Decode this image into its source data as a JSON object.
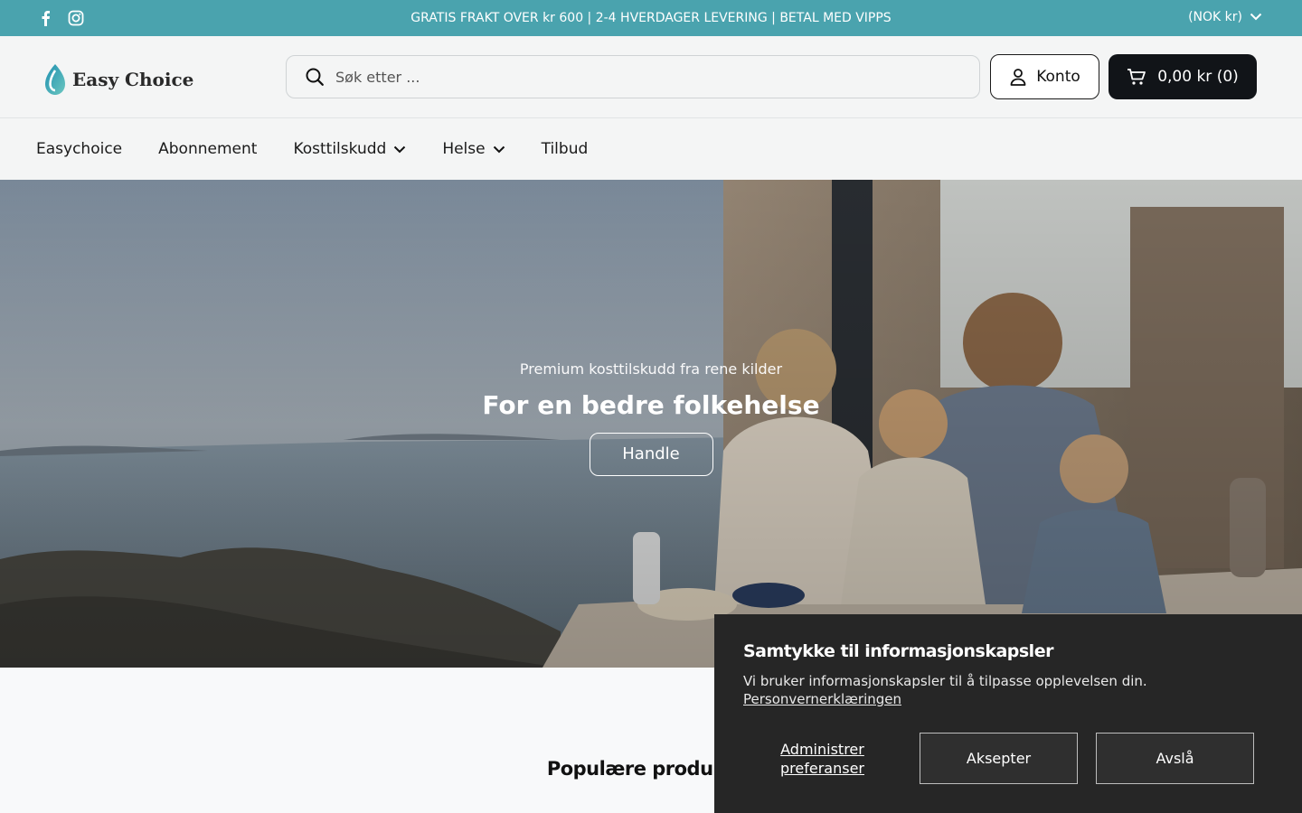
{
  "announcement": {
    "message": "GRATIS FRAKT OVER kr 600 | 2-4 HVERDAGER LEVERING | BETAL MED VIPPS",
    "currency": "(NOK kr)",
    "social": [
      "facebook-icon",
      "instagram-icon"
    ]
  },
  "header": {
    "logo_text": "Easy Choice",
    "search_placeholder": "Søk etter ...",
    "account_label": "Konto",
    "cart_label": "0,00 kr (0)"
  },
  "nav": {
    "items": [
      {
        "label": "Easychoice",
        "dropdown": false
      },
      {
        "label": "Abonnement",
        "dropdown": false
      },
      {
        "label": "Kosttilskudd",
        "dropdown": true
      },
      {
        "label": "Helse",
        "dropdown": true
      },
      {
        "label": "Tilbud",
        "dropdown": false
      }
    ]
  },
  "hero": {
    "kicker": "Premium kosttilskudd fra rene kilder",
    "headline": "For en bedre folkehelse",
    "cta": "Handle"
  },
  "products": {
    "heading": "Populære produkter"
  },
  "cookie": {
    "title": "Samtykke til informasjonskapsler",
    "text": "Vi bruker informasjonskapsler til å tilpasse opplevelsen din.",
    "policy_link": "Personvernerklæringen",
    "manage_label": "Administrer preferanser",
    "accept_label": "Aksepter",
    "decline_label": "Avslå"
  },
  "colors": {
    "announcement_bg": "#4aa3ae",
    "cart_bg": "#111418",
    "cookie_bg": "#262626"
  }
}
